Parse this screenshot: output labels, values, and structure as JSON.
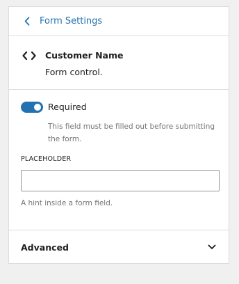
{
  "header": {
    "back_label": "Form Settings",
    "back_icon": "chevron-left-icon"
  },
  "block": {
    "icon": "code-icon",
    "title": "Customer Name",
    "description": "Form control."
  },
  "required_toggle": {
    "label": "Required",
    "checked": true,
    "help": "This field must be filled out before submitting the form."
  },
  "placeholder_field": {
    "label": "PLACEHOLDER",
    "value": "",
    "help": "A hint inside a form field."
  },
  "advanced": {
    "label": "Advanced",
    "icon": "chevron-down-icon"
  },
  "colors": {
    "accent": "#2271b1",
    "muted_text": "#757575",
    "border": "#dcdcde"
  }
}
